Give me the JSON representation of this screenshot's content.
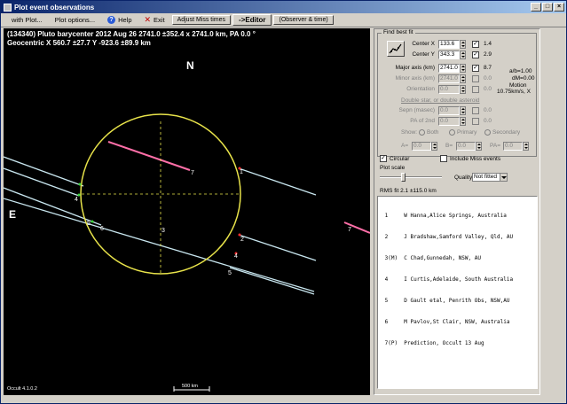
{
  "window": {
    "title": "Plot event observations",
    "controls": [
      "_",
      "□",
      "×"
    ]
  },
  "menu": {
    "with_plot": "with Plot...",
    "plot_options": "Plot options...",
    "help": "Help",
    "exit": "Exit",
    "adjust_miss": "Adjust Miss times",
    "editor": "->Editor",
    "observer_time": "(Observer & time)"
  },
  "plot": {
    "header_line1": "(134340) Pluto barycenter  2012 Aug 26  2741.0 ±352.4 x 2741.0 km, PA 0.0 °",
    "header_line2": "Geocentric  X  560.7 ±27.7  Y  -923.6 ±89.9 km",
    "north_label": "N",
    "east_label": "E",
    "version": "Occult 4.1.0.2",
    "scale_label": "500 km",
    "chord_labels": [
      "7",
      "1",
      "4",
      "3",
      "6",
      "5",
      "2",
      "4",
      "5",
      "7"
    ],
    "colors": {
      "background": "#000000",
      "ellipse": "#e8e34a",
      "chord": "#c8e6ef",
      "prediction": "#ff6fa8",
      "marker_green": "#3ad63a",
      "marker_red": "#ff3030"
    }
  },
  "fit": {
    "group_title": "Find best fit",
    "center_x_label": "Center X",
    "center_x_value": "133.6",
    "center_x_checked": "✓",
    "center_x_unc": "1.4",
    "center_y_label": "Center Y",
    "center_y_value": "343.3",
    "center_y_checked": "✓",
    "center_y_unc": "2.9",
    "major_label": "Major axis (km)",
    "major_value": "2741.0",
    "major_checked": "✓",
    "major_unc": "8.7",
    "minor_label": "Minor axis (km)",
    "minor_value": "2741.0",
    "minor_unc": "0.0",
    "orient_label": "Orientation",
    "orient_value": "0.0",
    "orient_unc": "0.0",
    "ab_label": "a/b=1.00",
    "dm_label": "dM=0.00",
    "motion_label": "Motion",
    "motion_value": "10.75km/s, X",
    "double_star_label": "Double star, or double asteroid",
    "sepn_label": "Sepn (masec)",
    "sepn_value": "0.0",
    "sepn_unc": "0.0",
    "pa2_label": "PA of 2nd",
    "pa2_value": "0.0",
    "pa2_unc": "0.0",
    "show_label": "Show:",
    "show_both": "Both",
    "show_primary": "Primary",
    "show_secondary": "Secondary",
    "a_label": "A=",
    "a_value": "0.0",
    "b_label": "B=",
    "b_value": "0.0",
    "pab_label": "PA=",
    "pab_value": "0.0"
  },
  "options": {
    "circular_label": "Circular",
    "circular_checked": "✓",
    "include_miss_label": "Include Miss events",
    "plot_scale_label": "Plot scale",
    "quality_label": "Quality",
    "quality_value": "Not fitted",
    "rms_label": "RMS fit 2.1 ±115.0 km"
  },
  "observers": [
    " 1     W Hanna,Alice Springs, Australia",
    " 2     J Bradshaw,Samford Valley, Qld, AU",
    " 3(M)  C Chad,Gunnedah, NSW, AU",
    " 4     I Curtis,Adelaide, South Australia",
    " 5     D Gault etal, Penrith Obs, NSW,AU",
    " 6     M Pavlov,St Clair, NSW, Australia",
    " 7(P)  Prediction, Occult 13 Aug"
  ]
}
